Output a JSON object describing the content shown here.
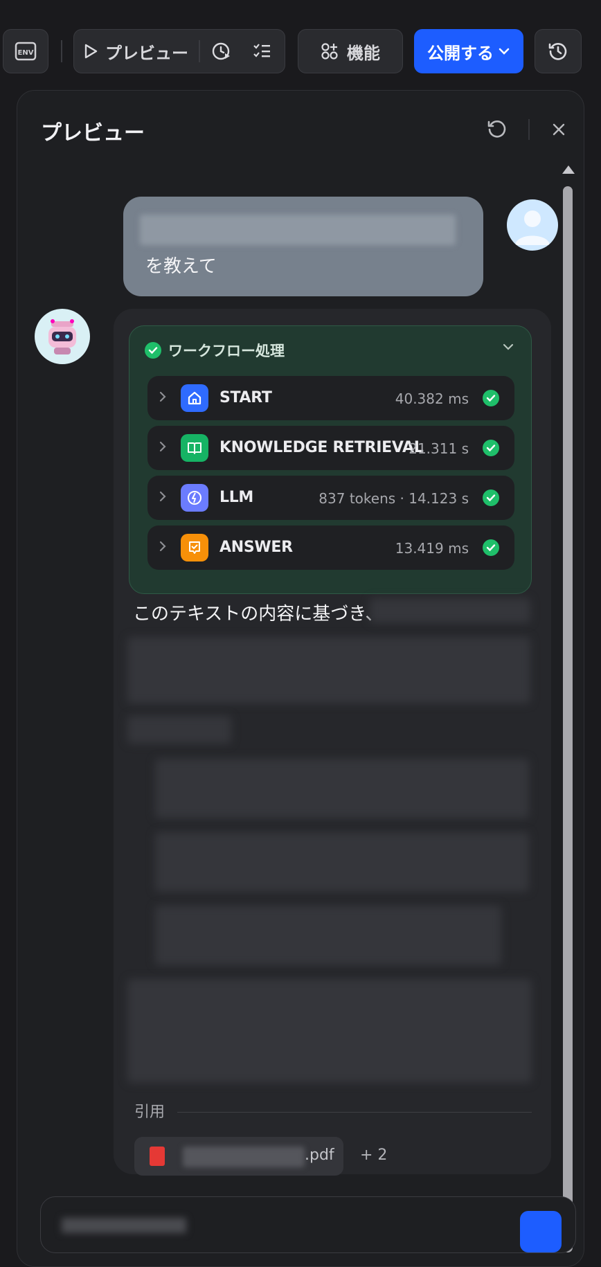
{
  "topbar": {
    "env_label": "ENV",
    "preview_label": "プレビュー",
    "features_label": "機能",
    "publish_label": "公開する"
  },
  "panel": {
    "title": "プレビュー"
  },
  "user_message": {
    "visible_text": "を教えて"
  },
  "workflow": {
    "title": "ワークフロー処理",
    "status_color": "#1fbf6a",
    "steps": [
      {
        "name": "START",
        "meta": "40.382 ms",
        "icon": "home-icon",
        "color": "#2f6bff"
      },
      {
        "name": "KNOWLEDGE RETRIEVAL",
        "meta": "21.311 s",
        "icon": "book-icon",
        "color": "#16b364"
      },
      {
        "name": "LLM",
        "meta": "837 tokens · 14.123 s",
        "icon": "llm-icon",
        "color": "#6b7cff"
      },
      {
        "name": "ANSWER",
        "meta": "13.419 ms",
        "icon": "answer-icon",
        "color": "#f79009"
      }
    ]
  },
  "answer": {
    "lead": "このテキストの内容に基づき、"
  },
  "citations": {
    "label": "引用",
    "file_ext": ".pdf",
    "more": "+ 2"
  },
  "colors": {
    "accent": "#1d5dff",
    "background": "#1a1a1d"
  }
}
